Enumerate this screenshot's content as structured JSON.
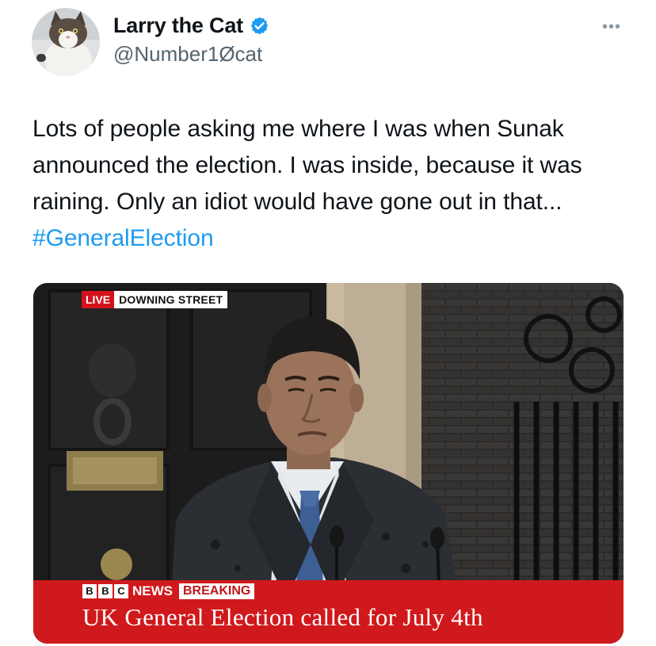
{
  "user": {
    "display_name": "Larry the Cat",
    "handle": "@Number1Øcat",
    "verified_icon": "verified-badge-icon",
    "avatar_icon": "cat-avatar"
  },
  "more_icon": "more-options-icon",
  "tweet": {
    "text_main": "Lots of people asking me where I was when Sunak announced the election. I was inside, because it was raining. Only an idiot would have gone out in that... ",
    "hashtag": "#GeneralElection"
  },
  "media": {
    "live_label": "LIVE",
    "location_label": "DOWNING STREET",
    "bbc_letters": [
      "B",
      "B",
      "C"
    ],
    "news_label": "NEWS",
    "breaking_label": "BREAKING",
    "headline": "UK General Election called for July 4th"
  },
  "colors": {
    "hashtag": "#1d9bf0",
    "verified": "#1d9bf0",
    "news_red": "#d0191c"
  }
}
